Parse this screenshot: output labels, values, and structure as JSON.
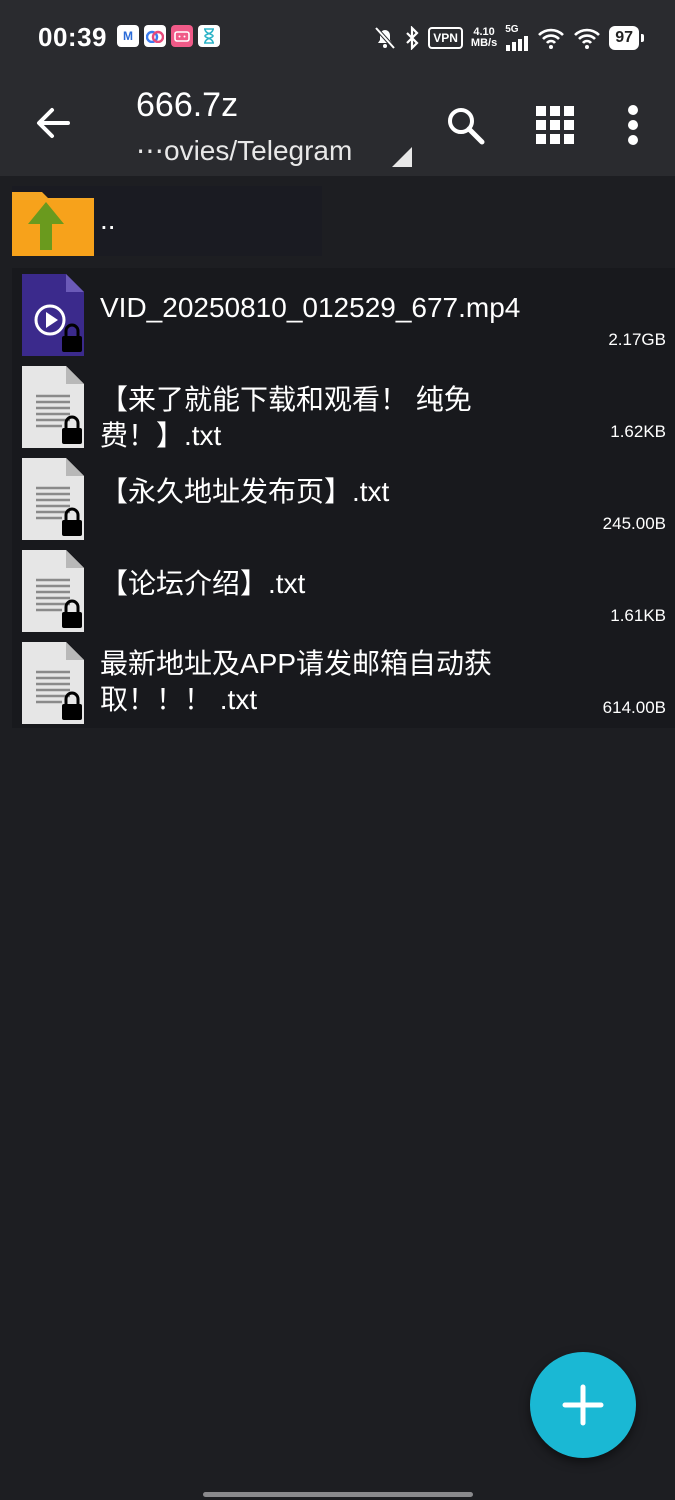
{
  "status_bar": {
    "time": "00:39",
    "vpn": "VPN",
    "speed_value": "4.10",
    "speed_unit": "MB/s",
    "network": "5G",
    "battery": "97",
    "notif_icons": [
      "gmail-icon",
      "baidu-netdisk-icon",
      "bilibili-icon",
      "hourglass-icon"
    ]
  },
  "toolbar": {
    "title": "666.7z",
    "path": "⋯ovies/Telegram"
  },
  "parent": {
    "label": ".."
  },
  "files": [
    {
      "name": "VID_20250810_012529_677.mp4",
      "size": "2.17GB",
      "type": "video",
      "locked": true
    },
    {
      "name": "【来了就能下载和观看！ 纯免费！】.txt",
      "size": "1.62KB",
      "type": "text",
      "locked": true
    },
    {
      "name": "【永久地址发布页】.txt",
      "size": "245.00B",
      "type": "text",
      "locked": true
    },
    {
      "name": "【论坛介绍】.txt",
      "size": "1.61KB",
      "type": "text",
      "locked": true
    },
    {
      "name": "最新地址及APP请发邮箱自动获取！！！ .txt",
      "size": "614.00B",
      "type": "text",
      "locked": true
    }
  ],
  "colors": {
    "background": "#1d1e22",
    "toolbar": "#2a2b2f",
    "fab": "#1ab8d4",
    "video_icon": "#3b2a8c",
    "folder": "#f5a623",
    "folder_arrow": "#6a9a1e"
  }
}
